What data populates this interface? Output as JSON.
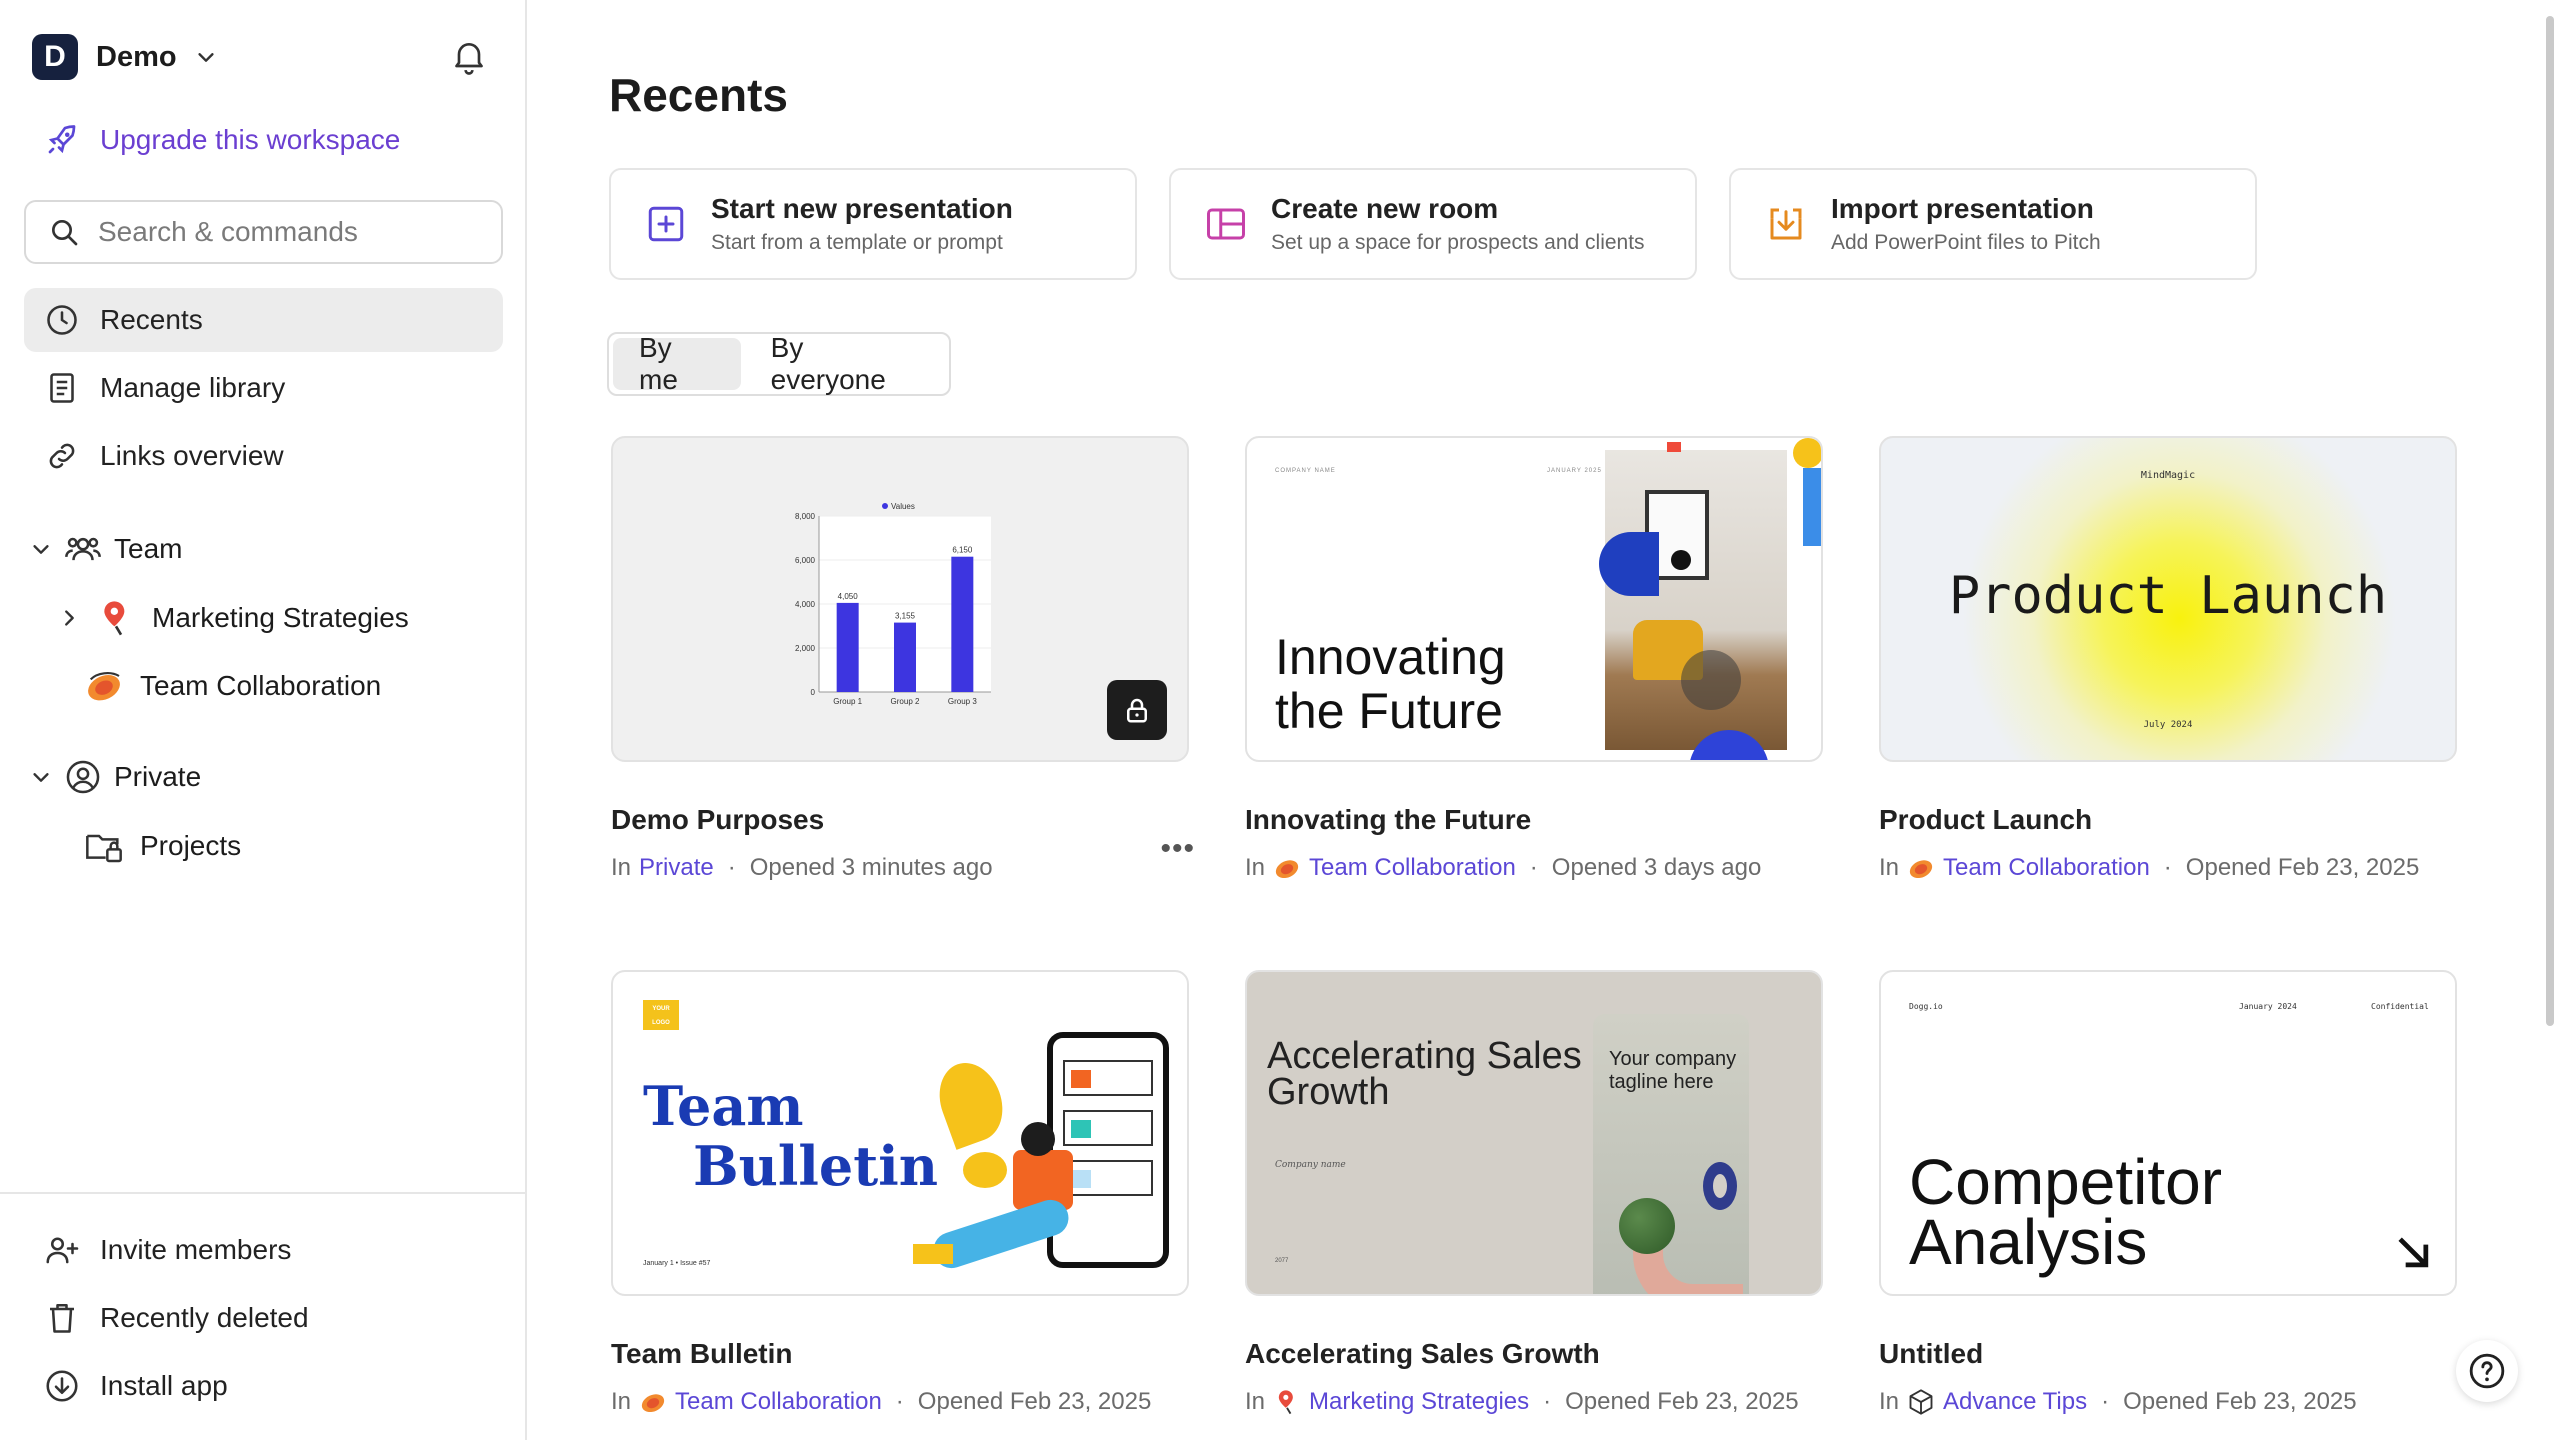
{
  "workspace": {
    "initial": "D",
    "name": "Demo"
  },
  "sidebar": {
    "upgrade": "Upgrade this workspace",
    "search_placeholder": "Search & commands",
    "nav": [
      {
        "label": "Recents",
        "icon": "clock-icon"
      },
      {
        "label": "Manage library",
        "icon": "book-icon"
      },
      {
        "label": "Links overview",
        "icon": "link-icon"
      }
    ],
    "team": {
      "label": "Team",
      "items": [
        {
          "label": "Marketing Strategies",
          "icon": "map-pin-icon"
        },
        {
          "label": "Team Collaboration",
          "icon": "planet-icon"
        }
      ]
    },
    "private": {
      "label": "Private",
      "items": [
        {
          "label": "Projects",
          "icon": "folder-lock-icon"
        }
      ]
    },
    "bottom": [
      {
        "label": "Invite members",
        "icon": "add-user-icon"
      },
      {
        "label": "Recently deleted",
        "icon": "trash-icon"
      },
      {
        "label": "Install app",
        "icon": "download-icon"
      }
    ]
  },
  "main": {
    "title": "Recents",
    "actions": [
      {
        "title": "Start new presentation",
        "subtitle": "Start from a template or prompt",
        "icon": "plus-square-icon"
      },
      {
        "title": "Create new room",
        "subtitle": "Set up a space for prospects and clients",
        "icon": "layout-icon"
      },
      {
        "title": "Import presentation",
        "subtitle": "Add PowerPoint files to Pitch",
        "icon": "import-icon"
      }
    ],
    "filter": {
      "by_me": "By me",
      "by_everyone": "By everyone"
    },
    "cards": [
      {
        "title": "Demo Purposes",
        "in": "In",
        "location": "Private",
        "opened": "Opened 3 minutes ago"
      },
      {
        "title": "Innovating the Future",
        "in": "In",
        "location": "Team Collaboration",
        "opened": "Opened 3 days ago"
      },
      {
        "title": "Product Launch",
        "in": "In",
        "location": "Team Collaboration",
        "opened": "Opened Feb 23, 2025"
      },
      {
        "title": "Team Bulletin",
        "in": "In",
        "location": "Team Collaboration",
        "opened": "Opened Feb 23, 2025"
      },
      {
        "title": "Accelerating Sales Growth",
        "in": "In",
        "location": "Marketing Strategies",
        "opened": "Opened Feb 23, 2025"
      },
      {
        "title": "Untitled",
        "in": "In",
        "location": "Advance Tips",
        "opened": "Opened Feb 23, 2025"
      }
    ],
    "thumbs": {
      "demo_chart": {
        "legend": "Values",
        "yticks": [
          "8,000",
          "6,000",
          "4,000",
          "2,000",
          "0"
        ],
        "categories": [
          "Group 1",
          "Group 2",
          "Group 3"
        ],
        "values": [
          4050,
          3155,
          6150
        ],
        "value_labels": [
          "4,050",
          "3,155",
          "6,150"
        ],
        "ymax": 8000
      },
      "innovating": {
        "company": "COMPANY NAME",
        "date": "JANUARY 2025",
        "line1": "Innovating",
        "line2": "the Future"
      },
      "product": {
        "brand": "MindMagic",
        "title": "Product Launch",
        "date": "July 2024"
      },
      "bulletin": {
        "logo": "YOUR LOGO",
        "line1": "Team",
        "line2": "Bulletin",
        "footer": "January 1  •  Issue #57"
      },
      "sales": {
        "title1": "Accelerating Sales",
        "title2": "Growth",
        "company": "Company name",
        "tagline1": "Your company",
        "tagline2": "tagline here",
        "year": "2077"
      },
      "competitor": {
        "brand": "Dogg.io",
        "date": "January 2024",
        "conf": "Confidential",
        "line1": "Competitor",
        "line2": "Analysis"
      }
    }
  }
}
